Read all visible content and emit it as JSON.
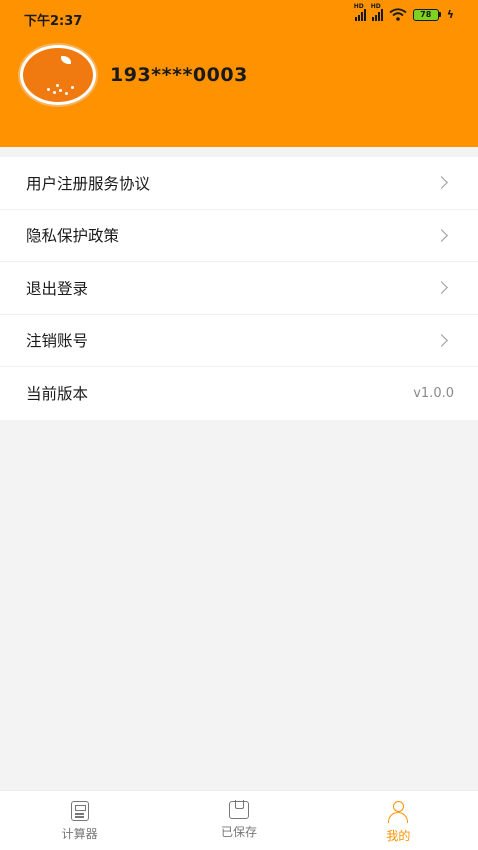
{
  "status_bar": {
    "time": "下午2:37",
    "signal_label_1": "HD",
    "signal_label_2": "HD",
    "battery": "78",
    "charging_glyph": "ϟ"
  },
  "profile": {
    "phone": "193****0003"
  },
  "menu": {
    "items": [
      {
        "label": "用户注册服务协议"
      },
      {
        "label": "隐私保护政策"
      },
      {
        "label": "退出登录"
      },
      {
        "label": "注销账号"
      },
      {
        "label": "当前版本",
        "value": "v1.0.0"
      }
    ]
  },
  "tabbar": {
    "tabs": [
      {
        "label": "计算器",
        "icon": "calculator-icon"
      },
      {
        "label": "已保存",
        "icon": "save-icon"
      },
      {
        "label": "我的",
        "icon": "user-icon",
        "active": true
      }
    ]
  },
  "colors": {
    "accent": "#ff9200",
    "background": "#f3f3f3"
  }
}
